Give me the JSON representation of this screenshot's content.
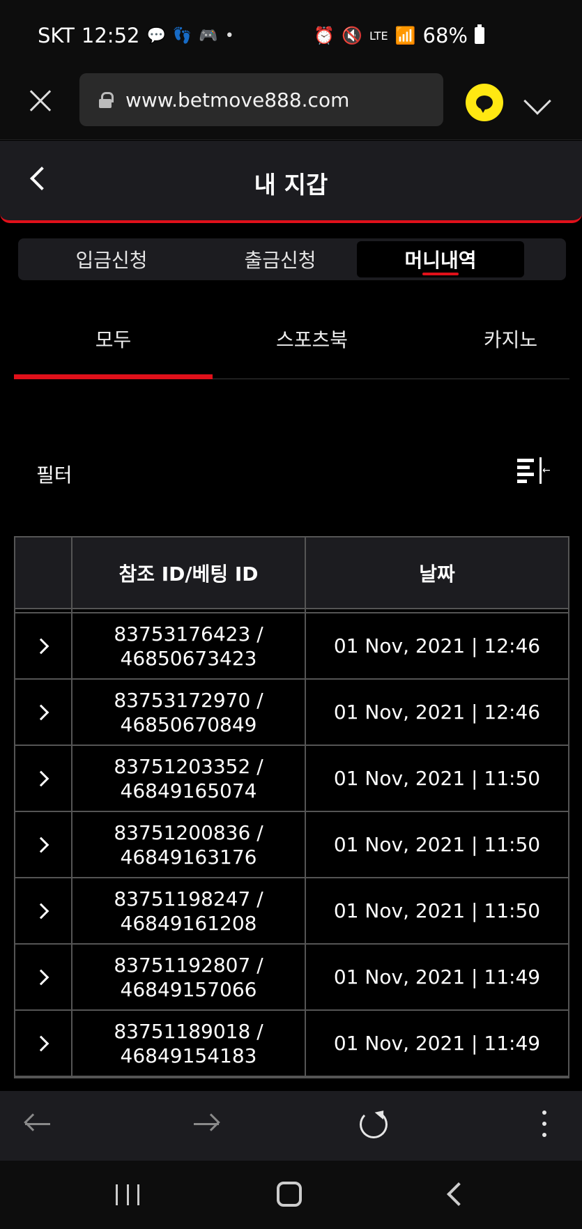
{
  "status_bar": {
    "carrier": "SKT",
    "time": "12:52",
    "network": "LTE",
    "battery": "68%"
  },
  "browser": {
    "url": "www.betmove888.com"
  },
  "header": {
    "title": "내 지갑"
  },
  "top_tabs": [
    {
      "label": "입금신청"
    },
    {
      "label": "출금신청"
    },
    {
      "label": "머니내역"
    }
  ],
  "sub_tabs": [
    {
      "label": "모두"
    },
    {
      "label": "스포츠북"
    },
    {
      "label": "카지노"
    }
  ],
  "filter": {
    "label": "필터"
  },
  "table": {
    "columns": [
      "",
      "참조 ID/베팅 ID",
      "날짜"
    ],
    "rows": [
      {
        "ref_id": "83753176423 /",
        "bet_id": "46850673423",
        "date": "01 Nov, 2021 | 12:46"
      },
      {
        "ref_id": "83753172970 /",
        "bet_id": "46850670849",
        "date": "01 Nov, 2021 | 12:46"
      },
      {
        "ref_id": "83751203352 /",
        "bet_id": "46849165074",
        "date": "01 Nov, 2021 | 11:50"
      },
      {
        "ref_id": "83751200836 /",
        "bet_id": "46849163176",
        "date": "01 Nov, 2021 | 11:50"
      },
      {
        "ref_id": "83751198247 /",
        "bet_id": "46849161208",
        "date": "01 Nov, 2021 | 11:50"
      },
      {
        "ref_id": "83751192807 /",
        "bet_id": "46849157066",
        "date": "01 Nov, 2021 | 11:49"
      },
      {
        "ref_id": "83751189018 /",
        "bet_id": "46849154183",
        "date": "01 Nov, 2021 | 11:49"
      }
    ]
  },
  "colors": {
    "accent": "#e0101a",
    "kakao": "#ffe812",
    "header_bg": "#1c1c20"
  }
}
